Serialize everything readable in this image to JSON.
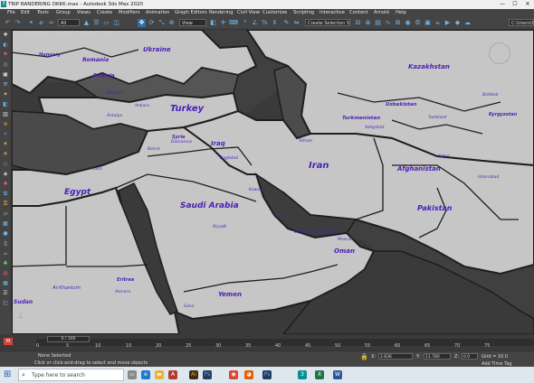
{
  "window": {
    "title": "TRIP RANDERING OKKK.max - Autodesk 3ds Max 2020",
    "app_icon": "3",
    "minimize": "—",
    "maximize": "☐",
    "close": "✕"
  },
  "menu": [
    "File",
    "Edit",
    "Tools",
    "Group",
    "Views",
    "Create",
    "Modifiers",
    "Animation",
    "Graph Editors",
    "Rendering",
    "Civil View",
    "Customize",
    "Scripting",
    "Interactive",
    "Content",
    "Arnold",
    "Help"
  ],
  "toolbar": {
    "filter_dropdown": "All",
    "view_dropdown": "View",
    "selection_set": "Create Selection Se",
    "workspace_path": "C:\\Users\\hsh"
  },
  "viewport": {
    "label": "[+] [Perspective] [Standard] [Default Shading]",
    "countries": [
      {
        "name": "Ukraine",
        "size": 7
      },
      {
        "name": "Hungary",
        "size": 5
      },
      {
        "name": "Romania",
        "size": 6
      },
      {
        "name": "Bulgaria",
        "size": 5
      },
      {
        "name": "Turkey",
        "size": 10
      },
      {
        "name": "Syria",
        "size": 5
      },
      {
        "name": "Iraq",
        "size": 7
      },
      {
        "name": "Iran",
        "size": 10
      },
      {
        "name": "Egypt",
        "size": 9
      },
      {
        "name": "Saudi Arabia",
        "size": 9
      },
      {
        "name": "Kazakhstan",
        "size": 7
      },
      {
        "name": "Uzbekistan",
        "size": 5.5
      },
      {
        "name": "Turkmenistan",
        "size": 5.5
      },
      {
        "name": "Kyrgyzstan",
        "size": 5
      },
      {
        "name": "Afghanistan",
        "size": 7
      },
      {
        "name": "Pakistan",
        "size": 8
      },
      {
        "name": "Oman",
        "size": 7
      },
      {
        "name": "Yemen",
        "size": 7
      },
      {
        "name": "Eritrea",
        "size": 5
      },
      {
        "name": "Sudan",
        "size": 6
      }
    ],
    "cities": [
      "Ankara",
      "Antalya",
      "Tehran",
      "Ashgabat",
      "Kabul",
      "Islamabad",
      "Riyadh",
      "Doha",
      "Muscat",
      "Sana",
      "Asmara",
      "Al-Khartum",
      "Damascus",
      "Baghdad",
      "United Arab Emirates",
      "Beirut",
      "Tashkent",
      "Bishkek",
      "Cairo",
      "Istanbul",
      "Kuwait"
    ]
  },
  "timeline": {
    "frame_indicator": "0 / 100",
    "ticks": [
      "0",
      "5",
      "10",
      "15",
      "20",
      "25",
      "30",
      "35",
      "40",
      "45",
      "50",
      "55",
      "60",
      "65",
      "70",
      "75"
    ]
  },
  "status": {
    "selection": "None Selected",
    "hint": "Click or click-and-drag to select and move objects",
    "x_label": "X:",
    "x_value": "2.836",
    "y_label": "Y:",
    "y_value": "11.780",
    "z_label": "Z:",
    "z_value": "0.0",
    "grid": "Grid = 10.0",
    "add_time_tag": "Add Time Tag"
  },
  "taskbar": {
    "search_placeholder": "Type here to search",
    "apps": [
      "Task View",
      "Edge",
      "File Explorer",
      "Autodesk",
      "Illustrator",
      "Photoshop",
      "Chrome",
      "Firefox",
      "Photoshop 2",
      "3ds Max",
      "Excel",
      "Word"
    ]
  }
}
